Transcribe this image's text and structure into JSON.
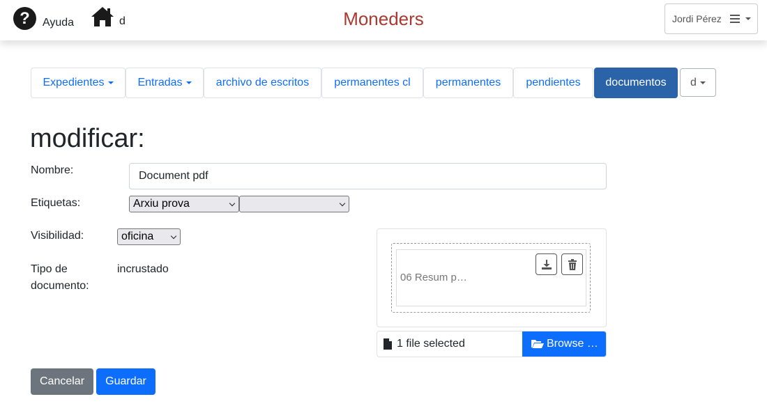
{
  "header": {
    "help_label": "Ayuda",
    "home_label": "d",
    "brand": "Moneders",
    "user_name": "Jordi Pérez",
    "brand_color": "#a83a32"
  },
  "tabs": [
    {
      "label": "Expedientes",
      "dropdown": true
    },
    {
      "label": "Entradas",
      "dropdown": true
    },
    {
      "label": "archivo de escritos"
    },
    {
      "label": "permanentes cl"
    },
    {
      "label": "permanentes"
    },
    {
      "label": "pendientes"
    },
    {
      "label": "documentos",
      "active": true
    },
    {
      "label": "d",
      "dropdown": true
    }
  ],
  "form": {
    "title": "modificar:",
    "nombre_label": "Nombre:",
    "nombre_value": "Document pdf",
    "etiquetas_label": "Etiquetas:",
    "etiqueta1_value": "Arxiu prova",
    "etiqueta2_value": "",
    "visibilidad_label": "Visibilidad:",
    "visibilidad_value": "oficina",
    "tipo_label_1": "Tipo de",
    "tipo_label_2": "documento:",
    "tipo_value": "incrustado"
  },
  "file": {
    "preview_name": "06 Resum p…",
    "caption": "1 file selected",
    "browse_label": "Browse …"
  },
  "actions": {
    "cancel_label": "Cancelar",
    "save_label": "Guardar"
  },
  "colors": {
    "primary": "#0d6efd",
    "active_tab": "#2b63a9",
    "secondary": "#6c757d"
  },
  "icons": [
    "question-circle-icon",
    "home-icon",
    "bars-icon",
    "download-icon",
    "trash-icon",
    "file-icon",
    "folder-open-icon"
  ]
}
